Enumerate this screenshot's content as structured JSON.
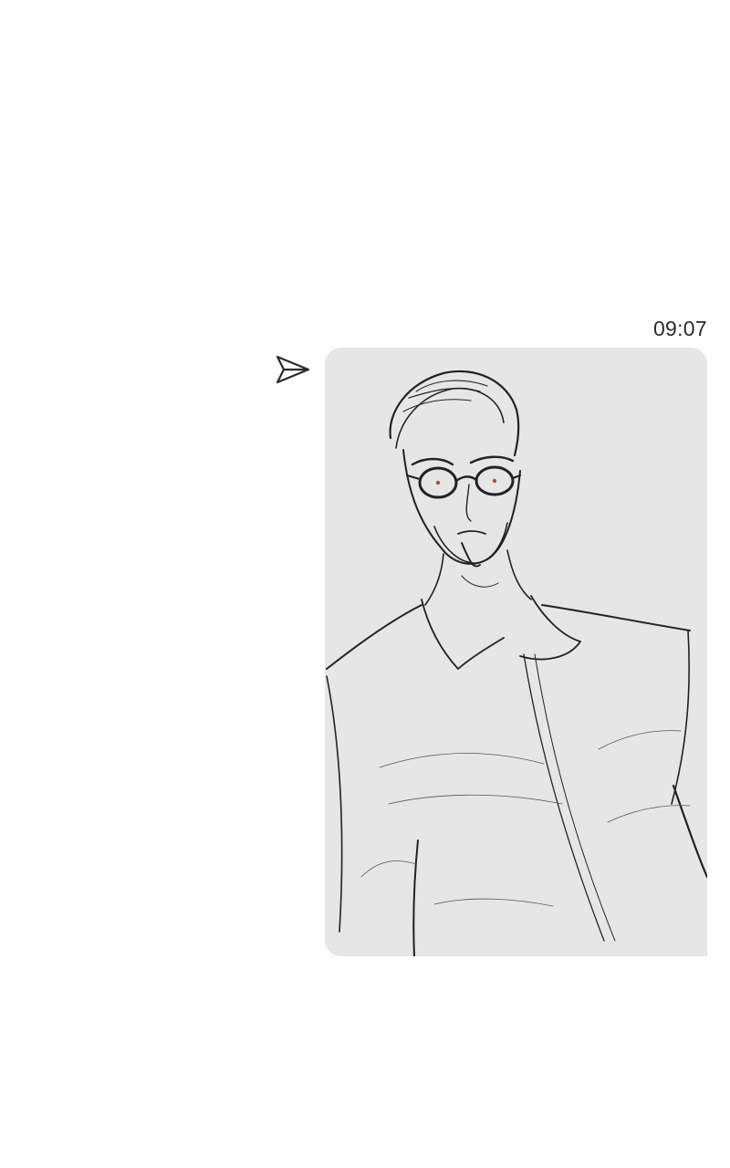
{
  "chat": {
    "message": {
      "time": "09:07",
      "status_icon": "send-icon",
      "attachment": {
        "type": "image",
        "subject": "pencil-sketch-portrait",
        "background": "#e6e6e6"
      }
    }
  },
  "colors": {
    "page_background": "#ffffff",
    "text": "#2b2b2b",
    "sketch_line": "#222222",
    "eye_accent": "#b34a3a"
  }
}
